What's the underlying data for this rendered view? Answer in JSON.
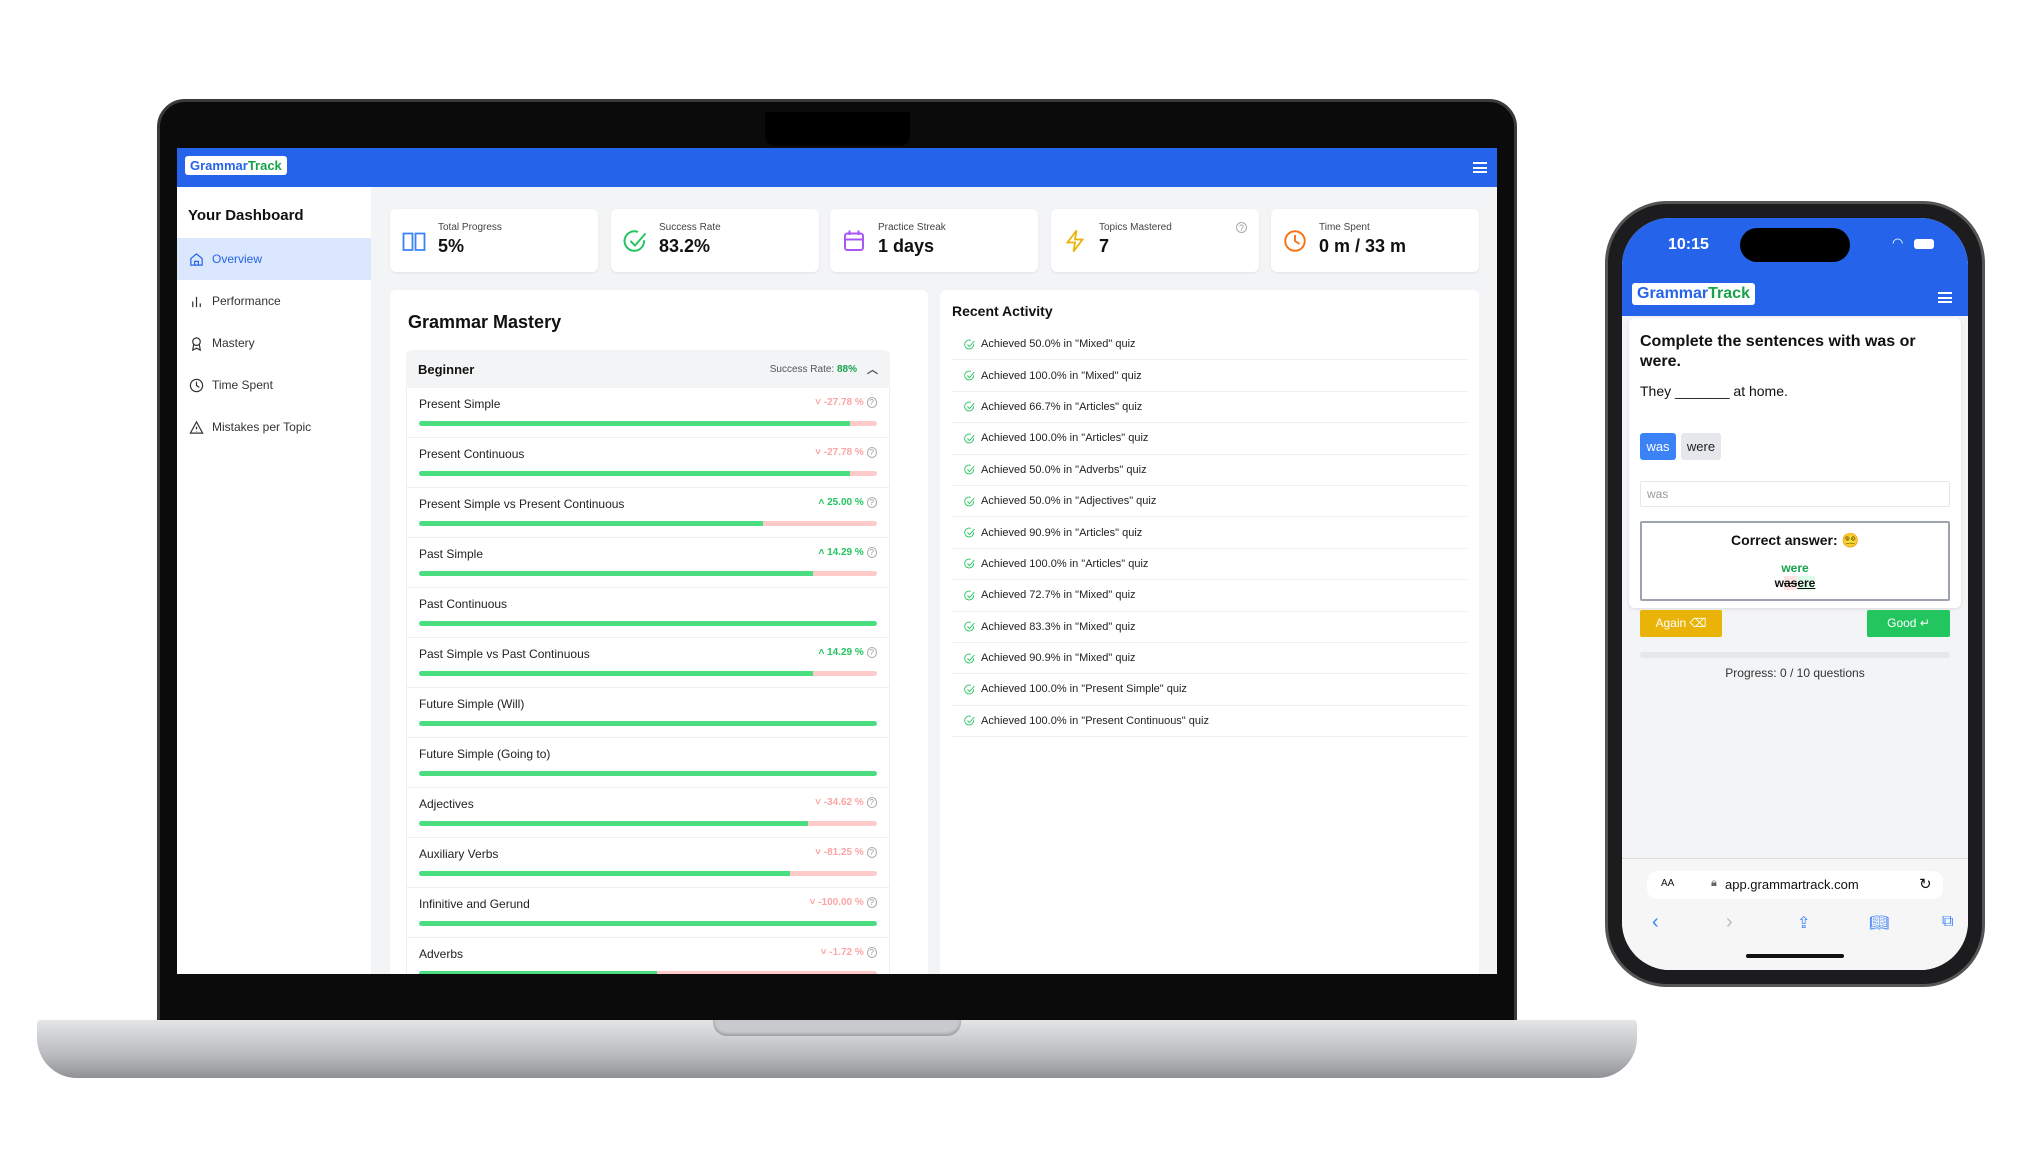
{
  "app": {
    "logo_part1": "Grammar",
    "logo_part2": "Track"
  },
  "sidebar": {
    "title": "Your Dashboard",
    "items": [
      {
        "label": "Overview",
        "icon": "home-icon",
        "active": true
      },
      {
        "label": "Performance",
        "icon": "bar-chart-icon"
      },
      {
        "label": "Mastery",
        "icon": "award-icon"
      },
      {
        "label": "Time Spent",
        "icon": "clock-icon"
      },
      {
        "label": "Mistakes per Topic",
        "icon": "warning-icon"
      }
    ]
  },
  "stats": [
    {
      "label": "Total Progress",
      "value": "5%",
      "icon": "book-icon",
      "color": "#3b82f6"
    },
    {
      "label": "Success Rate",
      "value": "83.2%",
      "icon": "check-circle-icon",
      "color": "#22c55e"
    },
    {
      "label": "Practice Streak",
      "value": "1 days",
      "icon": "calendar-icon",
      "color": "#a855f7"
    },
    {
      "label": "Topics Mastered",
      "value": "7",
      "icon": "lightning-icon",
      "color": "#eab308",
      "help": "?"
    },
    {
      "label": "Time Spent",
      "value": "0 m / 33 m",
      "icon": "clock-icon",
      "color": "#f97316"
    }
  ],
  "mastery": {
    "title": "Grammar Mastery",
    "level": "Beginner",
    "success_label": "Success Rate:",
    "success_value": "88%",
    "topics": [
      {
        "name": "Present Simple",
        "change": "-27.78 %",
        "dir": "down",
        "progress": 0.94
      },
      {
        "name": "Present Continuous",
        "change": "-27.78 %",
        "dir": "down",
        "progress": 0.94
      },
      {
        "name": "Present Simple vs Present Continuous",
        "change": "25.00 %",
        "dir": "up",
        "progress": 0.75
      },
      {
        "name": "Past Simple",
        "change": "14.29 %",
        "dir": "up",
        "progress": 0.86
      },
      {
        "name": "Past Continuous",
        "change": "",
        "dir": "",
        "progress": 1.0
      },
      {
        "name": "Past Simple vs Past Continuous",
        "change": "14.29 %",
        "dir": "up",
        "progress": 0.86
      },
      {
        "name": "Future Simple (Will)",
        "change": "",
        "dir": "",
        "progress": 1.0
      },
      {
        "name": "Future Simple (Going to)",
        "change": "",
        "dir": "",
        "progress": 1.0
      },
      {
        "name": "Adjectives",
        "change": "-34.62 %",
        "dir": "down",
        "progress": 0.85
      },
      {
        "name": "Auxiliary Verbs",
        "change": "-81.25 %",
        "dir": "down",
        "progress": 0.81
      },
      {
        "name": "Infinitive and Gerund",
        "change": "-100.00 %",
        "dir": "down",
        "progress": 1.0
      },
      {
        "name": "Adverbs",
        "change": "-1.72 %",
        "dir": "down",
        "progress": 0.52
      }
    ]
  },
  "activity": {
    "title": "Recent Activity",
    "items": [
      "Achieved 50.0% in \"Mixed\" quiz",
      "Achieved 100.0% in \"Mixed\" quiz",
      "Achieved 66.7% in \"Articles\" quiz",
      "Achieved 100.0% in \"Articles\" quiz",
      "Achieved 50.0% in \"Adverbs\" quiz",
      "Achieved 50.0% in \"Adjectives\" quiz",
      "Achieved 90.9% in \"Articles\" quiz",
      "Achieved 100.0% in \"Articles\" quiz",
      "Achieved 72.7% in \"Mixed\" quiz",
      "Achieved 83.3% in \"Mixed\" quiz",
      "Achieved 90.9% in \"Mixed\" quiz",
      "Achieved 100.0% in \"Present Simple\" quiz",
      "Achieved 100.0% in \"Present Continuous\" quiz"
    ]
  },
  "phone": {
    "time": "10:15",
    "question": "Complete the sentences with was or were.",
    "sentence": "They _______ at home.",
    "options": [
      "was",
      "were"
    ],
    "input_value": "was",
    "correct_label": "Correct answer:",
    "emoji": "😵‍💫",
    "correct_word": "were",
    "diff_removed": "as",
    "diff_prefix": "w",
    "diff_added": "ere",
    "again": "Again ⌫",
    "good": "Good ↵",
    "progress_text": "Progress: 0 / 10 questions",
    "progress": 0,
    "url": "app.grammartrack.com",
    "aa": "AA"
  }
}
